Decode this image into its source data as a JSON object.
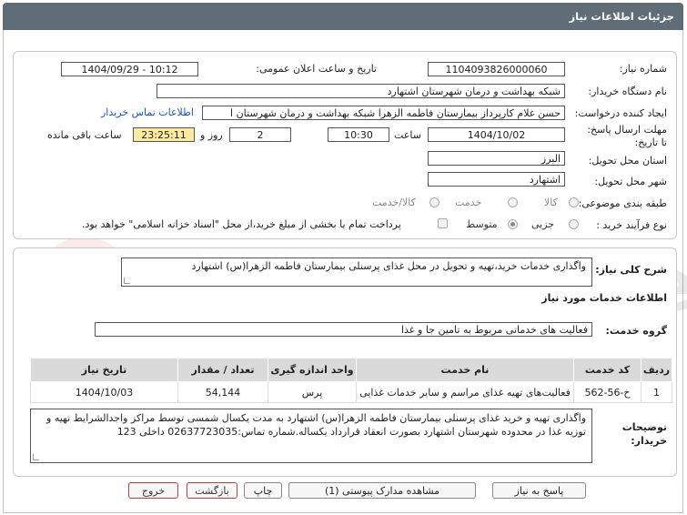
{
  "window": {
    "title": "جزئیات اطلاعات نیاز"
  },
  "form": {
    "need_number_label": "شماره نیاز:",
    "need_number": "1104093826000060",
    "announce_label": "تاریخ و ساعت اعلان عمومی:",
    "announce_value": "1404/09/29 - 10:12",
    "buyer_org_label": "نام دستگاه خریدار:",
    "buyer_org": "شبکه بهداشت و درمان شهرستان اشتهارد",
    "requester_label": "ایجاد کننده درخواست:",
    "requester": "حسن غلام کارپرداز بیمارستان فاطمه الزهرا شبکه بهداشت و درمان شهرستان ا",
    "contact_link": "اطلاعات تماس خریدار",
    "deadline_label": "مهلت ارسال پاسخ: تا تاریخ:",
    "deadline_date": "1404/10/02",
    "time_label": "ساعت",
    "deadline_time": "10:30",
    "days_value": "2",
    "days_label": "روز و",
    "remaining_time": "23:25:11",
    "remaining_label": "ساعت باقی مانده",
    "province_label": "استان محل تحویل:",
    "province": "البرز",
    "city_label": "شهر محل تحویل:",
    "city": "اشتهارد",
    "category_label": "طبقه بندی موضوعی:",
    "category_options": [
      "کالا",
      "خدمت",
      "کالا/خدمت"
    ],
    "process_label": "نوع فرآیند خرید :",
    "process_options": [
      "جزیی",
      "متوسط"
    ],
    "payment_note": "پرداخت تمام یا بخشی از مبلغ خرید،از محل \"اسناد خزانه اسلامی\" خواهد بود."
  },
  "summary": {
    "label": "شرح کلی نیاز:",
    "text": "واگذاری خدمات خرید،تهیه و تحویل در محل غذای پرسنلی بیمارستان فاطمه الزهرا(س) اشتهارد"
  },
  "services": {
    "heading": "اطلاعات خدمات مورد نیاز",
    "group_label": "گروه خدمت:",
    "group_value": "فعالیت های خدماتی مربوط به تامین جا و غذا"
  },
  "table": {
    "headers": [
      "ردیف",
      "کد خدمت",
      "نام خدمت",
      "واحد اندازه گیری",
      "تعداد / مقدار",
      "تاریخ نیاز"
    ],
    "rows": [
      [
        "1",
        "خ-56-562",
        "فعالیت‌های تهیه غذای مراسم و سایر خدمات غذایی",
        "پرس",
        "54,144",
        "1404/10/03"
      ]
    ]
  },
  "buyer_notes": {
    "label": "توضیحات خریدار:",
    "text": "واگذاری تهیه و خرید غذای پرسنلی بیمارستان فاطمه الزهرا(س) اشتهارد به مدت یکسال شمسی توسط مراکز واجدالشرایط تهیه و توزیه غذا در محدوده شهرستان اشتهارد بصورت انعقاد قرارداد یکساله.شماره تماس:02637723035 داخلی 123"
  },
  "buttons": {
    "respond": "پاسخ به نیاز",
    "attachments": "مشاهده مدارک پیوستی (1)",
    "print": "چاپ",
    "back": "بازگشت",
    "exit": "خروج"
  },
  "watermark": {
    "text": "AriaTender.net"
  },
  "colors": {
    "titlebar": "#606c76",
    "link": "#1a55c0",
    "clock": "#fbeaa0",
    "table_header": "#dadada"
  }
}
